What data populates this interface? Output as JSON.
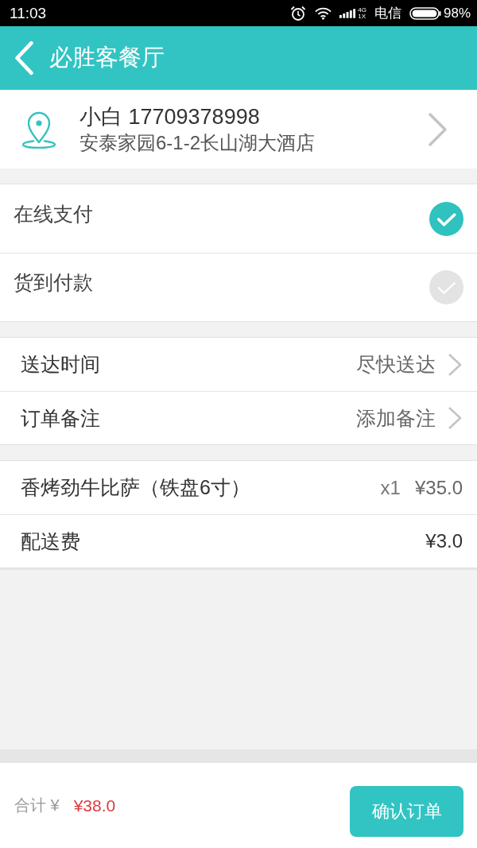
{
  "status_bar": {
    "time": "11:03",
    "network_type": "4G",
    "network_type_2": "1X",
    "carrier": "电信",
    "battery": "98%"
  },
  "header": {
    "title": "必胜客餐厅"
  },
  "address": {
    "name_phone": "小白 17709378998",
    "address": "安泰家园6-1-2长山湖大酒店"
  },
  "payment_methods": [
    {
      "label": "在线支付",
      "selected": true
    },
    {
      "label": "货到付款",
      "selected": false
    }
  ],
  "options": [
    {
      "label": "送达时间",
      "value": "尽快送达"
    },
    {
      "label": "订单备注",
      "value": "添加备注"
    }
  ],
  "order_items": [
    {
      "kind": "product",
      "name": "香烤劲牛比萨（铁盘6寸）",
      "quantity": "x1",
      "price": "¥35.0"
    },
    {
      "kind": "fee",
      "name": "配送费",
      "price": "¥3.0"
    }
  ],
  "footer": {
    "total_label": "合计 ¥",
    "total": "¥38.0",
    "confirm_button": "确认订单"
  }
}
